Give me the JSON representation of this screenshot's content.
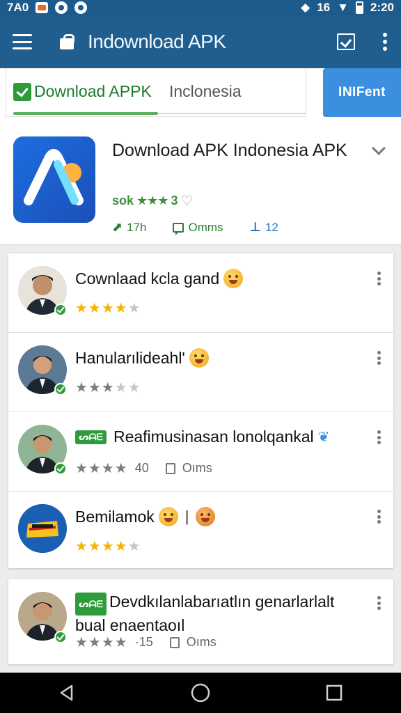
{
  "status_bar": {
    "left_text": "7A0",
    "right_signal": "16",
    "time": "2:20"
  },
  "toolbar": {
    "title": "Indownload APK",
    "menu_icon": "menu-icon",
    "bag_icon": "shopping-bag-icon",
    "action_icon": "checkbox-icon",
    "overflow_icon": "overflow-menu-icon"
  },
  "tabs": {
    "download_label": "Download APPK",
    "indonesia_label": "Inclonesia",
    "install_label": "INIFent"
  },
  "app": {
    "title": "Download APK Indonesia APK",
    "rating_prefix": "sok",
    "rating_stars": "★★★",
    "rating_suffix": "3",
    "stats": {
      "downloads": "17h",
      "comments": "Omms",
      "size": "12"
    }
  },
  "reviews": [
    {
      "title": "Cownlaad kcla gand",
      "stars_filled": 4,
      "stars_total": 5,
      "star_color": "#f5b400"
    },
    {
      "title": "Hanularılideahl'",
      "stars_filled": 3,
      "stars_total": 5,
      "star_color": "#7d7d7d"
    },
    {
      "tag": "ᔕᗩᗴ",
      "title": "Reafimusinasan lonolqankal",
      "rating_text": "40",
      "comments_text": "Oıms"
    },
    {
      "title": "Bemilamok",
      "stars_filled": 4,
      "stars_total": 5,
      "star_color": "#f5b400"
    },
    {
      "tag": "ᔕᗩᗴ",
      "title": "Devdkılanlabarıatlın genarlarlalt bual enaentaoıl",
      "rating_text": "·15",
      "comments_text": "Oıms"
    }
  ],
  "colors": {
    "primary": "#1f5e8f",
    "accent_green": "#2e9c3c",
    "install_blue": "#3b8fde",
    "star_gold": "#f5b400"
  }
}
